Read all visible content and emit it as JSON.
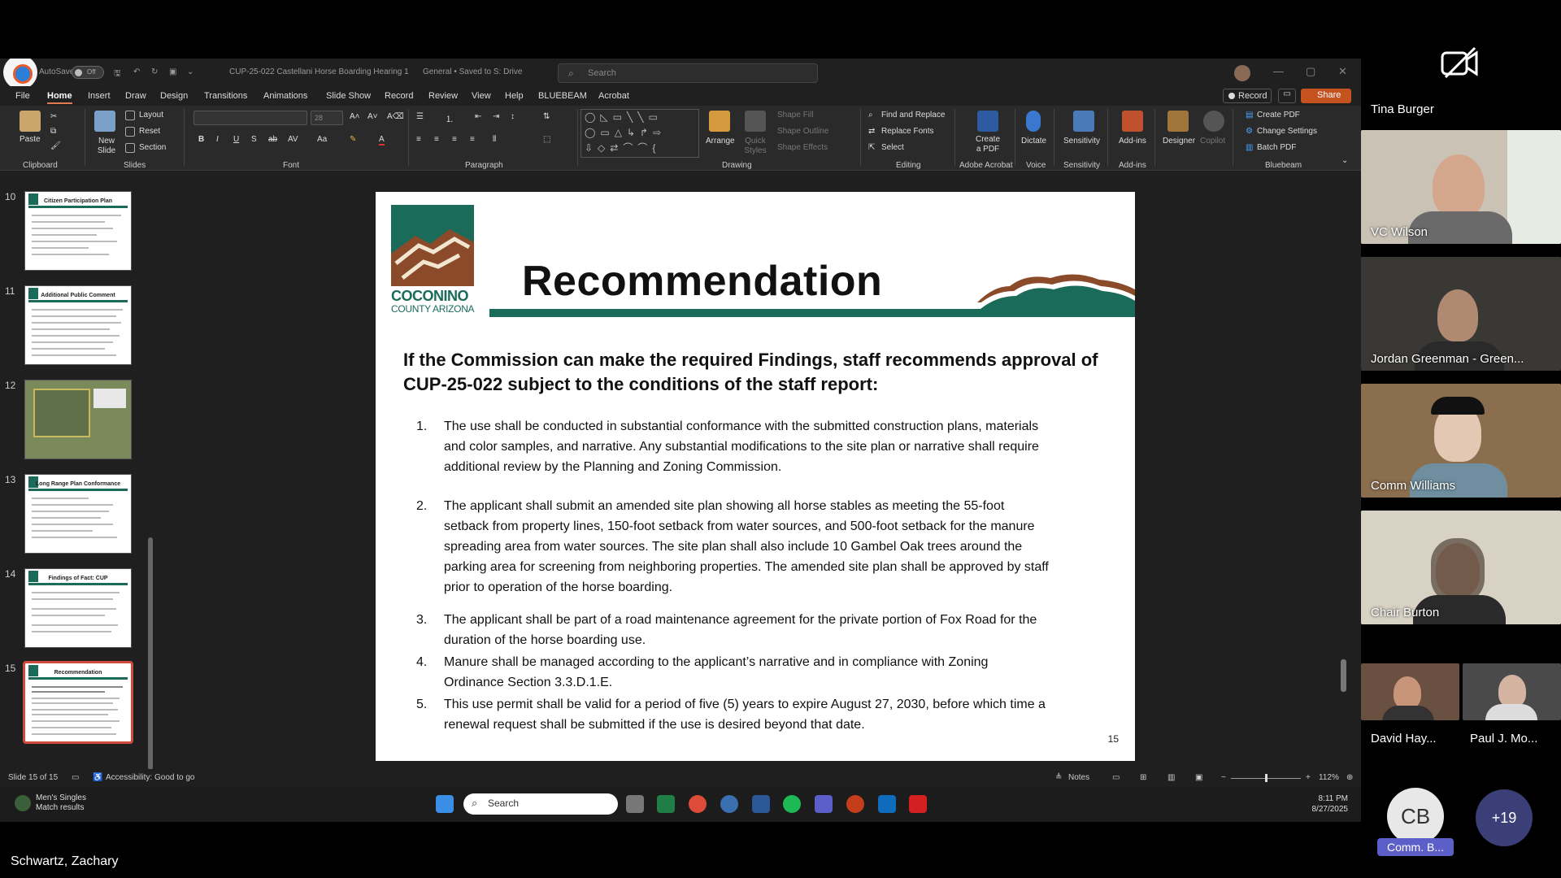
{
  "titlebar": {
    "autosave_label": "AutoSave",
    "autosave_state": "Off",
    "doc_title": "CUP-25-022 Castellani Horse Boarding Hearing 1",
    "sensitivity": "General • Saved to S: Drive",
    "search_placeholder": "Search"
  },
  "menu": {
    "tabs": [
      "File",
      "Home",
      "Insert",
      "Draw",
      "Design",
      "Transitions",
      "Animations",
      "Slide Show",
      "Record",
      "Review",
      "View",
      "Help",
      "BLUEBEAM",
      "Acrobat"
    ],
    "active": "Home",
    "record_label": "Record",
    "share_label": "Share"
  },
  "ribbon": {
    "paste": "Paste",
    "new_slide": "New Slide",
    "layout": "Layout",
    "reset": "Reset",
    "section": "Section",
    "font_size": "28",
    "arrange": "Arrange",
    "quick_styles": "Quick Styles",
    "shape_fill": "Shape Fill",
    "shape_outline": "Shape Outline",
    "shape_effects": "Shape Effects",
    "find_replace": "Find and Replace",
    "replace_fonts": "Replace Fonts",
    "select": "Select",
    "create_pdf_acro": "Create a PDF",
    "dictate": "Dictate",
    "sensitivity": "Sensitivity",
    "addins": "Add-ins",
    "designer": "Designer",
    "copilot": "Copilot",
    "create_pdf": "Create PDF",
    "change_settings": "Change Settings",
    "batch_pdf": "Batch PDF",
    "groups": {
      "clipboard": "Clipboard",
      "slides": "Slides",
      "font": "Font",
      "paragraph": "Paragraph",
      "drawing": "Drawing",
      "editing": "Editing",
      "adobe": "Adobe Acrobat",
      "voice": "Voice",
      "sensitivity": "Sensitivity",
      "addins": "Add-ins",
      "bluebeam": "Bluebeam"
    }
  },
  "thumbnails": [
    {
      "num": "10",
      "title": "Citizen Participation Plan"
    },
    {
      "num": "11",
      "title": "Additional Public Comment"
    },
    {
      "num": "12",
      "title": ""
    },
    {
      "num": "13",
      "title": "Long Range Plan Conformance"
    },
    {
      "num": "14",
      "title": "Findings of Fact: CUP"
    },
    {
      "num": "15",
      "title": "Recommendation"
    }
  ],
  "slide": {
    "title": "Recommendation",
    "logo_line1": "COCONINO",
    "logo_line2": "COUNTY ARIZONA",
    "lead": "If the Commission can make the required Findings, staff recommends approval of CUP-25-022 subject to the conditions of the staff report:",
    "conditions": [
      {
        "n": "1.",
        "text": "The use shall be conducted in substantial conformance with the submitted construction plans, materials and color samples, and narrative.  Any substantial modifications to the site plan or narrative shall require additional review by the Planning and Zoning Commission."
      },
      {
        "n": "2.",
        "text": "The applicant shall submit an amended site plan showing all horse stables as meeting the 55-foot setback from property lines, 150-foot setback from water sources, and 500-foot setback for the manure spreading area from water sources.  The site plan shall also include 10 Gambel Oak trees around the parking area for screening from neighboring properties. The amended site plan shall be approved by staff prior to operation of the horse boarding."
      },
      {
        "n": "3.",
        "text": "The applicant shall be part of a road maintenance agreement for the private portion of Fox Road for the duration of the horse boarding use."
      },
      {
        "n": "4.",
        "text": "Manure shall be managed according to the applicant’s narrative and in compliance with Zoning Ordinance Section 3.3.D.1.E."
      },
      {
        "n": "5.",
        "text": "This use permit shall be valid for a period of five (5) years to expire August 27, 2030, before which time a renewal request shall be submitted if the use is desired beyond that date."
      }
    ],
    "page_number": "15"
  },
  "statusbar": {
    "slide_info": "Slide 15 of 15",
    "accessibility": "Accessibility: Good to go",
    "notes": "Notes",
    "zoom": "112%"
  },
  "taskbar": {
    "notice_line1": "Men's Singles",
    "notice_line2": "Match results",
    "search": "Search",
    "time": "8:11 PM",
    "date": "8/27/2025"
  },
  "participants": {
    "presenter": "Tina Burger",
    "tiles": [
      "VC Wilson",
      "Jordan Greenman - Green...",
      "Comm Williams",
      "Chair Burton"
    ],
    "small_tiles": [
      "David Hay...",
      "Paul J. Mo..."
    ],
    "avatar_initials": "CB",
    "avatar_name": "Comm. B...",
    "more_count": "+19",
    "screen_sharer": "Schwartz, Zachary"
  },
  "colors": {
    "accent": "#c4531f",
    "coconino_teal": "#1a6b5a",
    "coconino_brown": "#8b4a2a",
    "selected_thumb": "#d04a3c"
  }
}
